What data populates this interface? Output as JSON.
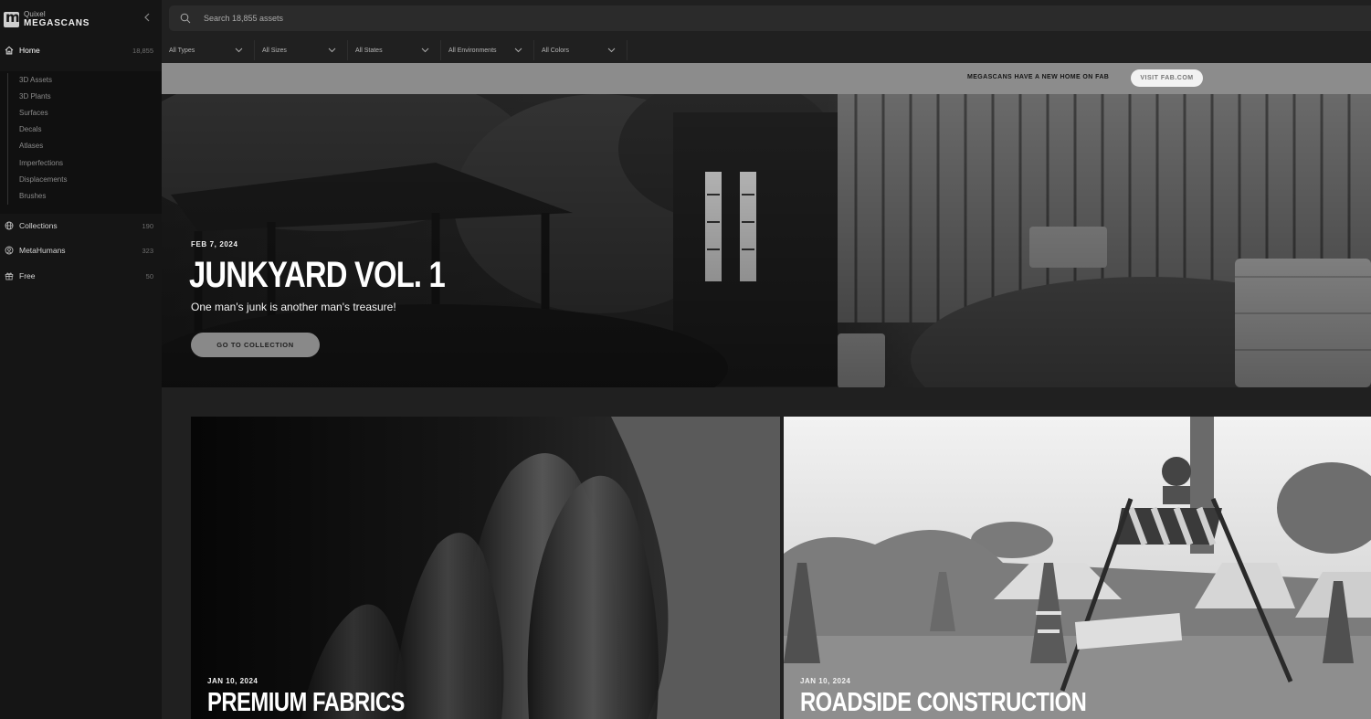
{
  "brand": {
    "name_small": "Quixel",
    "name_large": "MEGASCANS"
  },
  "sidebar": {
    "home": {
      "label": "Home",
      "count": "18,855"
    },
    "subitems": [
      "3D Assets",
      "3D Plants",
      "Surfaces",
      "Decals",
      "Atlases",
      "Imperfections",
      "Displacements",
      "Brushes"
    ],
    "collections": {
      "label": "Collections",
      "count": "190"
    },
    "metahumans": {
      "label": "MetaHumans",
      "count": "323"
    },
    "free": {
      "label": "Free",
      "count": "50"
    }
  },
  "search": {
    "placeholder": "Search 18,855 assets"
  },
  "filters": [
    "All Types",
    "All Sizes",
    "All States",
    "All Environments",
    "All Colors"
  ],
  "banner": {
    "text": "MEGASCANS HAVE A NEW HOME ON FAB",
    "button": "VISIT FAB.COM"
  },
  "hero": {
    "date": "FEB 7, 2024",
    "title": "JUNKYARD VOL. 1",
    "subtitle": "One man's junk is another man's treasure!",
    "button": "GO TO COLLECTION"
  },
  "cards": [
    {
      "date": "JAN 10, 2024",
      "title": "PREMIUM FABRICS"
    },
    {
      "date": "JAN 10, 2024",
      "title": "ROADSIDE CONSTRUCTION"
    }
  ],
  "colors": {
    "sidebar_bg": "#151515",
    "page_bg": "#202020",
    "banner_bg": "#8c8c8c",
    "text": "#dddddd"
  },
  "icons": {
    "home": "home-icon",
    "collections": "globe-icon",
    "metahumans": "user-circle-icon",
    "free": "gift-icon",
    "search": "search-icon",
    "filter": "chevron-down-icon",
    "collapse": "chevron-left-icon"
  }
}
